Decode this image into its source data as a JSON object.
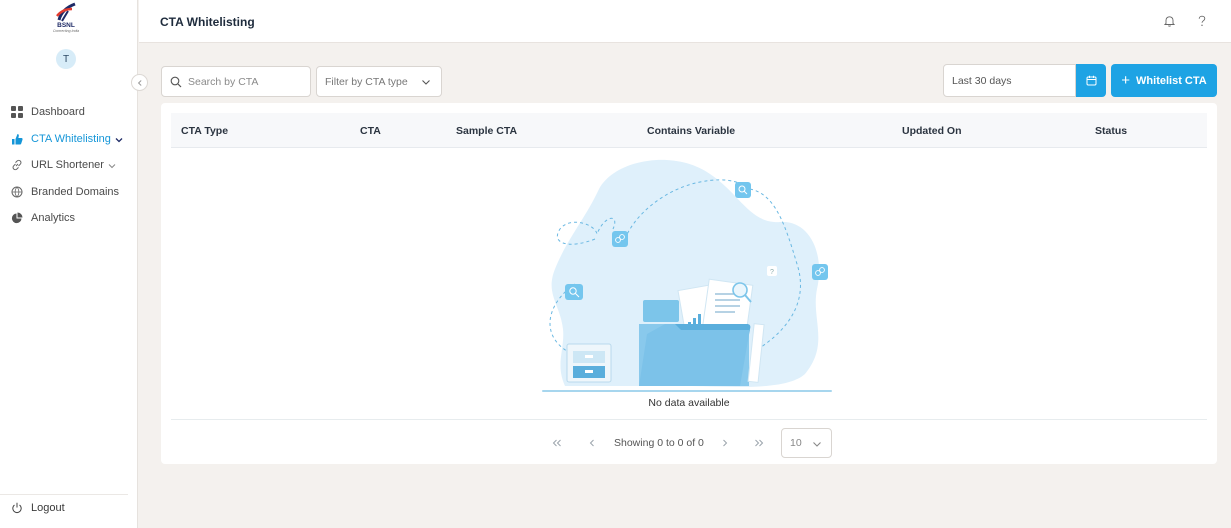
{
  "sidebar": {
    "logo": {
      "brand": "BSNL",
      "tagline": "Connecting India"
    },
    "avatar_initial": "T",
    "items": [
      {
        "label": "Dashboard",
        "icon": "grid-icon",
        "active": false
      },
      {
        "label": "CTA Whitelisting",
        "icon": "thumb-icon",
        "active": true,
        "expandable": true
      },
      {
        "label": "URL Shortener",
        "icon": "link-icon",
        "active": false,
        "expandable": true
      },
      {
        "label": "Branded Domains",
        "icon": "globe-icon",
        "active": false
      },
      {
        "label": "Analytics",
        "icon": "pie-chart-icon",
        "active": false
      }
    ],
    "logout_label": "Logout"
  },
  "header": {
    "title": "CTA Whitelisting",
    "icons": [
      "bell-icon",
      "help-icon"
    ]
  },
  "toolbar": {
    "search_placeholder": "Search by CTA",
    "filter_placeholder": "Filter by CTA type",
    "date_range": "Last 30 days",
    "primary_button": "Whitelist CTA"
  },
  "table": {
    "columns": [
      "CTA Type",
      "CTA",
      "Sample CTA",
      "Contains Variable",
      "Updated On",
      "Status"
    ],
    "rows": [],
    "empty_text": "No data available"
  },
  "pagination": {
    "info": "Showing 0 to 0 of 0",
    "per_page": "10"
  },
  "colors": {
    "accent": "#1ea3e4",
    "active_nav": "#1596d8",
    "page_bg": "#f4f1ee",
    "illustration": "#dff0fb"
  }
}
